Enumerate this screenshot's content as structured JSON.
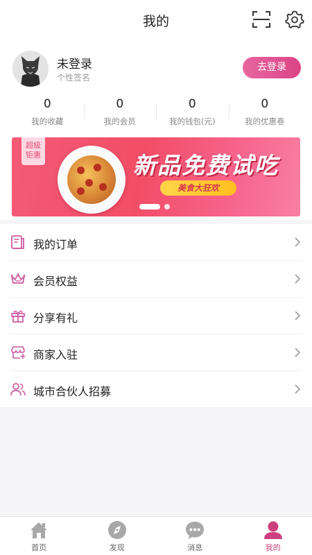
{
  "header": {
    "title": "我的"
  },
  "profile": {
    "username": "未登录",
    "signature": "个性签名",
    "login_button": "去登录",
    "stats": [
      {
        "value": "0",
        "label": "我的收藏"
      },
      {
        "value": "0",
        "label": "我的会员"
      },
      {
        "value": "0",
        "label": "我的钱包(元)"
      },
      {
        "value": "0",
        "label": "我的优惠卷"
      }
    ]
  },
  "banner": {
    "badge": "超级\n钜惠",
    "headline": "新品免费试吃",
    "subline": "美食大狂欢"
  },
  "menu": {
    "items": [
      {
        "label": "我的订单",
        "icon": "order-icon"
      },
      {
        "label": "会员权益",
        "icon": "crown-icon"
      },
      {
        "label": "分享有礼",
        "icon": "gift-icon"
      },
      {
        "label": "商家入驻",
        "icon": "store-icon"
      },
      {
        "label": "城市合伙人招募",
        "icon": "partner-icon"
      }
    ]
  },
  "tabbar": {
    "items": [
      {
        "label": "首页",
        "icon": "home-icon"
      },
      {
        "label": "发现",
        "icon": "compass-icon"
      },
      {
        "label": "消息",
        "icon": "message-icon"
      },
      {
        "label": "我的",
        "icon": "user-icon"
      }
    ],
    "active": "我的"
  },
  "colors": {
    "accent": "#d94485",
    "icon_pink": "#cc5aa0",
    "banner": "#f24d66"
  }
}
